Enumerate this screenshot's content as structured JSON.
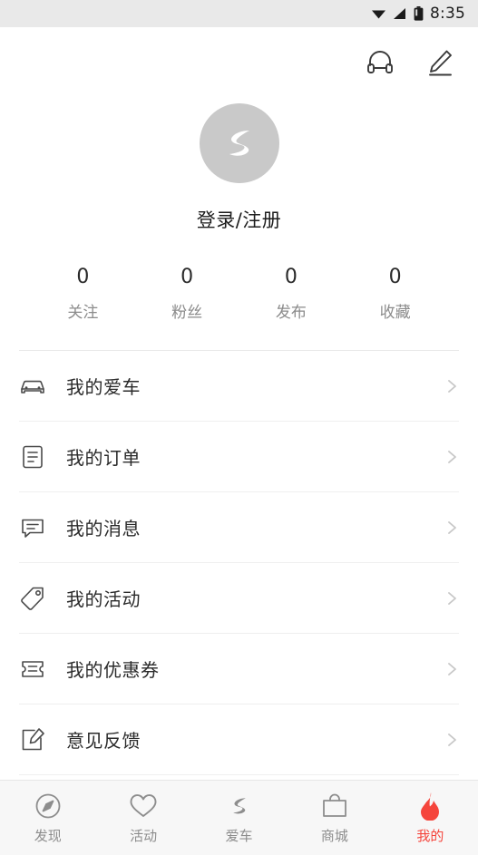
{
  "statusbar": {
    "time": "8:35",
    "icons": [
      "wifi-icon",
      "signal-icon",
      "battery-icon"
    ]
  },
  "header": {
    "support_icon": "headset-icon",
    "edit_icon": "pencil-icon"
  },
  "profile": {
    "avatar_icon": "brand-logo-icon",
    "login_label": "登录/注册"
  },
  "stats": [
    {
      "value": "0",
      "label": "关注"
    },
    {
      "value": "0",
      "label": "粉丝"
    },
    {
      "value": "0",
      "label": "发布"
    },
    {
      "value": "0",
      "label": "收藏"
    }
  ],
  "menu": [
    {
      "label": "我的爱车",
      "icon": "car-icon"
    },
    {
      "label": "我的订单",
      "icon": "order-list-icon"
    },
    {
      "label": "我的消息",
      "icon": "message-bubble-icon"
    },
    {
      "label": "我的活动",
      "icon": "tag-icon"
    },
    {
      "label": "我的优惠券",
      "icon": "coupon-icon"
    },
    {
      "label": "意见反馈",
      "icon": "feedback-icon"
    }
  ],
  "tabbar": [
    {
      "label": "发现",
      "icon": "compass-icon",
      "active": false
    },
    {
      "label": "活动",
      "icon": "heart-icon",
      "active": false
    },
    {
      "label": "爱车",
      "icon": "brand-logo-icon",
      "active": false
    },
    {
      "label": "商城",
      "icon": "shop-bag-icon",
      "active": false
    },
    {
      "label": "我的",
      "icon": "flame-icon",
      "active": true
    }
  ],
  "colors": {
    "accent": "#f5453c",
    "statusbar_bg": "#e9e9e9",
    "tabbar_bg": "#f7f7f7",
    "muted_text": "#8b8b8b"
  }
}
